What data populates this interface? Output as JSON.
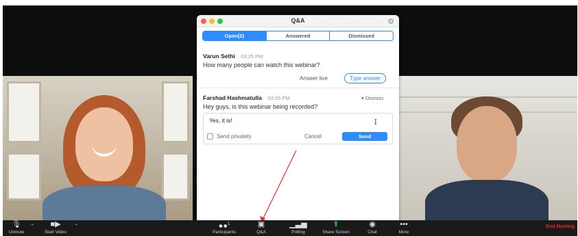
{
  "qa_panel": {
    "title": "Q&A",
    "tabs": [
      {
        "label": "Open(2)",
        "active": true
      },
      {
        "label": "Answered",
        "active": false
      },
      {
        "label": "Dismissed",
        "active": false
      }
    ],
    "questions": [
      {
        "name": "Varun Sethi",
        "time": "03:25 PM",
        "text": "How many people can watch this webinar?",
        "answer_live_label": "Answer live",
        "type_answer_label": "Type answer"
      },
      {
        "name": "Farshad Hashmatulla",
        "time": "03:55 PM",
        "text": "Hey guys, is this webinar being recorded?",
        "dismiss_label": "▾ Dismiss"
      }
    ],
    "answer": {
      "value": "Yes, it is!",
      "send_privately_label": "Send privately",
      "cancel_label": "Cancel",
      "send_label": "Send"
    }
  },
  "toolbar": {
    "items": [
      {
        "label": "Unmute",
        "icon": "microphone-muted-icon",
        "glyph": "🎙"
      },
      {
        "label": "Start Video",
        "icon": "video-off-icon",
        "glyph": "■"
      },
      {
        "label": "Participants",
        "icon": "participants-icon",
        "glyph": "👥",
        "badge": "1"
      },
      {
        "label": "Q&A",
        "icon": "qa-icon",
        "glyph": "▣"
      },
      {
        "label": "Polling",
        "icon": "polling-icon",
        "glyph": "▁▃▅"
      },
      {
        "label": "Share Screen",
        "icon": "share-screen-icon",
        "glyph": "⬆"
      },
      {
        "label": "Chat",
        "icon": "chat-icon",
        "glyph": "💬"
      },
      {
        "label": "More",
        "icon": "more-icon",
        "glyph": "•••"
      }
    ],
    "end_label": "End Meeting"
  },
  "colors": {
    "accent": "#2d8cff",
    "share_green": "#1fbd41",
    "end_red": "#e02828"
  }
}
